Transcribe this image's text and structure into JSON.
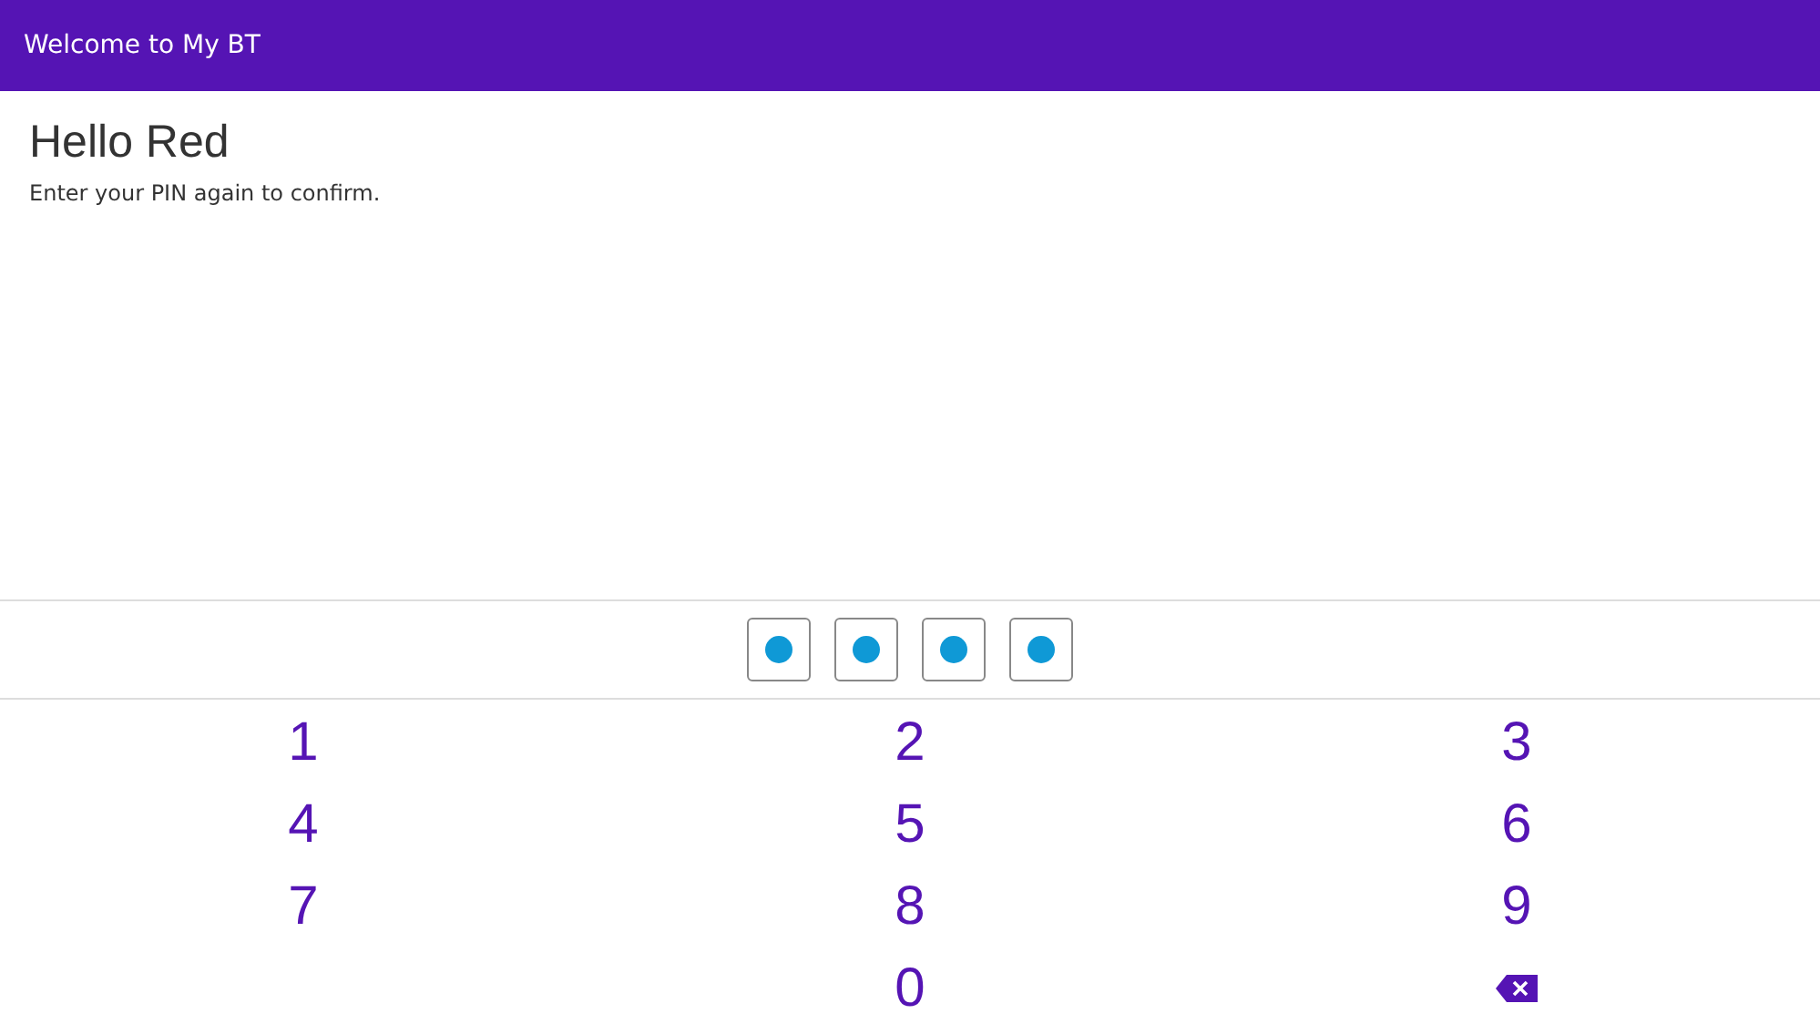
{
  "header": {
    "title": "Welcome to My BT"
  },
  "greeting": "Hello Red",
  "instruction": "Enter your PIN again to confirm.",
  "pin": [
    {
      "filled": true
    },
    {
      "filled": true
    },
    {
      "filled": true
    },
    {
      "filled": true
    }
  ],
  "keypad": [
    {
      "kind": "digit",
      "label": "1"
    },
    {
      "kind": "digit",
      "label": "2"
    },
    {
      "kind": "digit",
      "label": "3"
    },
    {
      "kind": "digit",
      "label": "4"
    },
    {
      "kind": "digit",
      "label": "5"
    },
    {
      "kind": "digit",
      "label": "6"
    },
    {
      "kind": "digit",
      "label": "7"
    },
    {
      "kind": "digit",
      "label": "8"
    },
    {
      "kind": "digit",
      "label": "9"
    },
    {
      "kind": "blank"
    },
    {
      "kind": "digit",
      "label": "0"
    },
    {
      "kind": "backspace"
    }
  ]
}
